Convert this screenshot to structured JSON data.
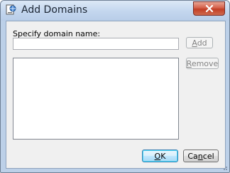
{
  "window": {
    "title": "Add Domains",
    "close_icon": "close-icon",
    "app_icon": "domain-app-icon"
  },
  "form": {
    "domain_label": "Specify domain name:",
    "domain_value": "",
    "list_items": []
  },
  "buttons": {
    "add": {
      "prefix": "",
      "underline": "A",
      "rest": "dd",
      "enabled": false
    },
    "remove": {
      "prefix": "",
      "underline": "R",
      "rest": "emove",
      "enabled": false
    },
    "ok": {
      "prefix": "",
      "underline": "O",
      "rest": "K",
      "enabled": true
    },
    "cancel": {
      "prefix": "Ca",
      "underline": "n",
      "rest": "cel",
      "enabled": true
    }
  },
  "colors": {
    "titlebar": "#c3d6ee",
    "close_button": "#c13e26",
    "dialog_bg": "#f0f0f0",
    "default_button_border": "#3c7fb1"
  }
}
